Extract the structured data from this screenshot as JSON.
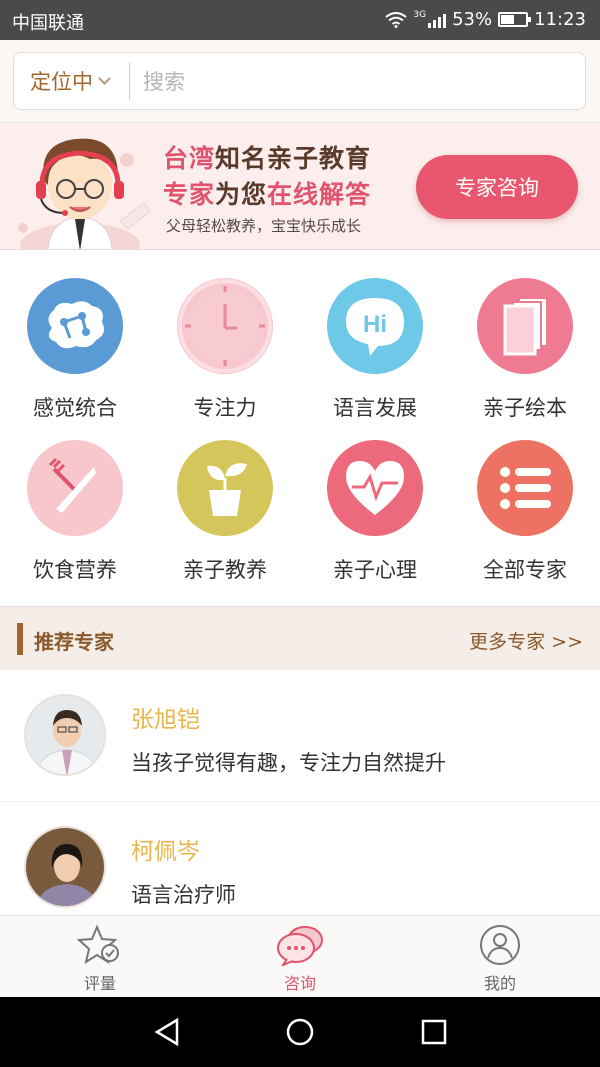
{
  "status_bar": {
    "carrier": "中国联通",
    "network": "3G",
    "battery": "53%",
    "battery_level": 0.53,
    "time": "11:23"
  },
  "search": {
    "location_label": "定位中",
    "placeholder": "搜索"
  },
  "banner": {
    "line1_a": "台湾",
    "line1_b": "知名亲子教育",
    "line2_a": "专家",
    "line2_b": "为您",
    "line2_c": "在线解答",
    "subtitle": "父母轻松教养，宝宝快乐成长",
    "button": "专家咨询"
  },
  "categories": [
    {
      "label": "感觉统合",
      "icon": "brain-icon",
      "color": "#5b9bd5"
    },
    {
      "label": "专注力",
      "icon": "clock-icon",
      "color": "#f8c8cf"
    },
    {
      "label": "语言发展",
      "icon": "hi-bubble-icon",
      "color": "#6ec8e8"
    },
    {
      "label": "亲子绘本",
      "icon": "book-icon",
      "color": "#ee7b92"
    },
    {
      "label": "饮食营养",
      "icon": "fork-knife-icon",
      "color": "#f7c7cc"
    },
    {
      "label": "亲子教养",
      "icon": "plant-icon",
      "color": "#d4c65a"
    },
    {
      "label": "亲子心理",
      "icon": "heart-pulse-icon",
      "color": "#ec6a7c"
    },
    {
      "label": "全部专家",
      "icon": "list-icon",
      "color": "#ee7263"
    }
  ],
  "recommended": {
    "title": "推荐专家",
    "more": "更多专家 >>"
  },
  "experts": [
    {
      "name": "张旭铠",
      "desc": "当孩子觉得有趣，专注力自然提升"
    },
    {
      "name": "柯佩岑",
      "desc": "语言治疗师"
    }
  ],
  "tabs": [
    {
      "label": "评量",
      "icon": "star-check-icon"
    },
    {
      "label": "咨询",
      "icon": "chat-bubbles-icon",
      "active": true
    },
    {
      "label": "我的",
      "icon": "user-icon"
    }
  ]
}
